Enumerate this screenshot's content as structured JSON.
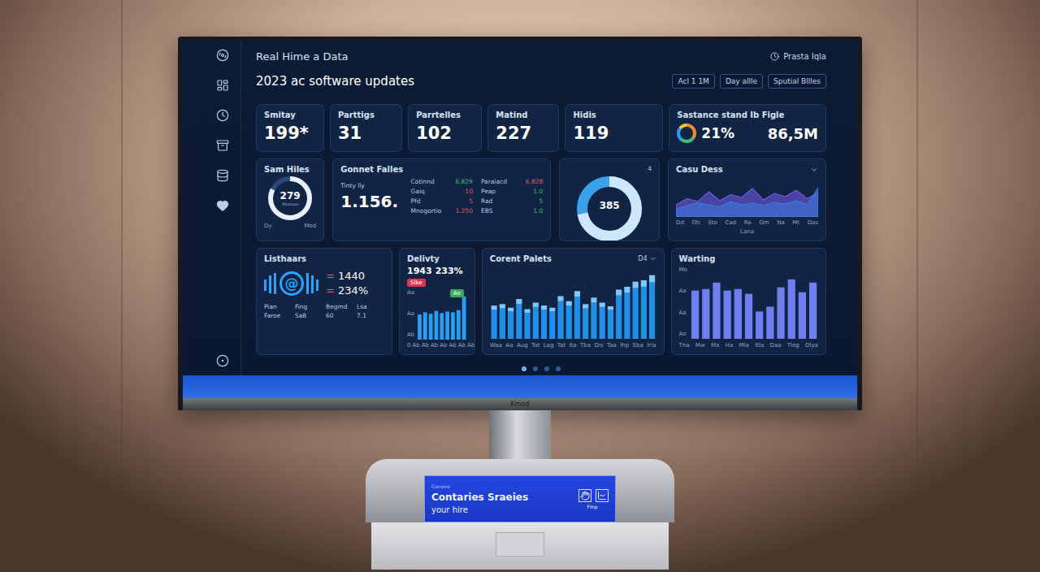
{
  "monitor": {
    "brand": "Kmod"
  },
  "header": {
    "title": "Real Hime a Data",
    "subtitle": "2023 ac software updates",
    "clock_label": "Prasta Iqla",
    "buttons": [
      {
        "label": "Acl 1 1M",
        "selected": false
      },
      {
        "label": "Day allle",
        "selected": false
      },
      {
        "label": "Sputial Bllles",
        "selected": false
      }
    ]
  },
  "stats": [
    {
      "label": "Smitay",
      "value": "199*"
    },
    {
      "label": "Parttigs",
      "value": "31"
    },
    {
      "label": "Parrtelles",
      "value": "102"
    },
    {
      "label": "Matind",
      "value": "227"
    },
    {
      "label": "Hidis",
      "value": "119"
    }
  ],
  "summary": {
    "label": "Sastance stand Ib Figle",
    "percent": "21%",
    "total": "86,5M",
    "segments": [
      {
        "level": 0.35,
        "color": "#f28c28"
      },
      {
        "level": 0.25,
        "color": "#3fbf6f"
      },
      {
        "level": 0.25,
        "color": "#2a9df4"
      },
      {
        "level": 0.15,
        "color": "#e8c93a"
      }
    ]
  },
  "ring_card": {
    "label": "Sam Hiles",
    "value": "279",
    "caption": "Illuvuuu",
    "left_tick": "Dy",
    "right_tick": "Mod",
    "level": 0.82
  },
  "files_card": {
    "label": "Gonnet Falles",
    "sub_label": "Tinty lly",
    "value": "1.156.",
    "columns": [
      [
        {
          "name": "Cotinnd",
          "value": "6.829",
          "color": "#3fbf6f"
        },
        {
          "name": "Gaiq",
          "value": "10",
          "color": "#e0566b"
        },
        {
          "name": "Pfd",
          "value": "5",
          "color": "#e0566b"
        },
        {
          "name": "Mnogortio",
          "value": "1.250",
          "color": "#e0566b"
        }
      ],
      [
        {
          "name": "Paraiacd",
          "value": "6.828",
          "color": "#e0566b"
        },
        {
          "name": "Peap",
          "value": "1.0",
          "color": "#3fbf6f"
        },
        {
          "name": "Rad",
          "value": "5",
          "color": "#3fbf6f"
        },
        {
          "name": "EBS",
          "value": "1.0",
          "color": "#3fbf6f"
        }
      ]
    ]
  },
  "donut_card": {
    "value": "385",
    "corner": "4",
    "level": 0.72
  },
  "area_chart": {
    "title": "Casu Dess",
    "axis_label": "Lana",
    "x_ticks": [
      "Dd",
      "Oti",
      "Sto",
      "Cad",
      "Ra",
      "Om",
      "Na",
      "Mt",
      "Das"
    ],
    "max": 100,
    "series": [
      {
        "values": [
          30,
          45,
          38,
          62,
          40,
          55,
          48,
          70,
          42,
          58,
          50,
          66,
          45,
          60
        ],
        "color": "#7a5cf0"
      },
      {
        "values": [
          20,
          28,
          35,
          30,
          25,
          38,
          30,
          34,
          28,
          36,
          32,
          40,
          30,
          72
        ],
        "color": "#3b7fe0"
      }
    ]
  },
  "listeners": {
    "title": "Listhaars",
    "symbol": "@",
    "readings": [
      {
        "mark": "=",
        "value": "1440"
      },
      {
        "mark": "=",
        "value": "234%"
      }
    ],
    "table": {
      "columns": [
        "Pian",
        "Fing",
        "Begmd",
        "Lsa"
      ],
      "rows": [
        [
          "Faroe",
          "Sa8",
          "60",
          "7.1"
        ]
      ]
    }
  },
  "delivery": {
    "title": "Delivty",
    "value": "1943",
    "change": "233%",
    "badge": "Slke",
    "flag": "Ao",
    "y_ticks": [
      "Aa",
      "Aa",
      "Ab"
    ],
    "x_ticks": [
      "0",
      "Ab",
      "Ab",
      "Ab",
      "Ab",
      "Ab",
      "Ab",
      "Ab"
    ],
    "max": 70,
    "values": [
      35,
      38,
      36,
      40,
      37,
      39,
      38,
      41,
      60
    ]
  },
  "current_chart": {
    "title": "Corent Palets",
    "range": "D4",
    "max": 100,
    "x_ticks": [
      "Waa",
      "Aa",
      "Aug",
      "Tot",
      "Lag",
      "Tat",
      "Ita",
      "Tba",
      "Dis",
      "Taa",
      "Ihp",
      "Eba",
      "Iria"
    ],
    "series": [
      {
        "values": [
          40,
          42,
          38,
          48,
          36,
          44,
          40,
          38,
          52,
          46,
          58,
          42,
          50,
          44,
          40,
          60,
          64,
          70,
          72,
          78
        ],
        "color": "#1f8fe8"
      },
      {
        "values": [
          6,
          6,
          5,
          7,
          5,
          6,
          6,
          5,
          7,
          6,
          8,
          6,
          7,
          6,
          5,
          8,
          8,
          9,
          9,
          10
        ],
        "color": "#7cc8ff"
      }
    ]
  },
  "waiting_chart": {
    "title": "Warting",
    "y_ticks": [
      "Mo",
      "Aa",
      "Aa",
      "Ao"
    ],
    "max": 90,
    "x_ticks": [
      "Tna",
      "Mw",
      "Ma",
      "Ha",
      "Mla",
      "Itla",
      "Daa",
      "Tlog",
      "Dlya"
    ],
    "values": [
      60,
      62,
      70,
      60,
      62,
      56,
      34,
      40,
      64,
      74,
      58,
      70
    ]
  },
  "pager": [
    {
      "selected": true
    },
    {
      "selected": false
    },
    {
      "selected": false
    },
    {
      "selected": false
    }
  ],
  "stand_panel": {
    "caption": "Conovo",
    "lines": [
      "Contaries Sraeies",
      "your hire"
    ],
    "button_label": "Fmp"
  }
}
